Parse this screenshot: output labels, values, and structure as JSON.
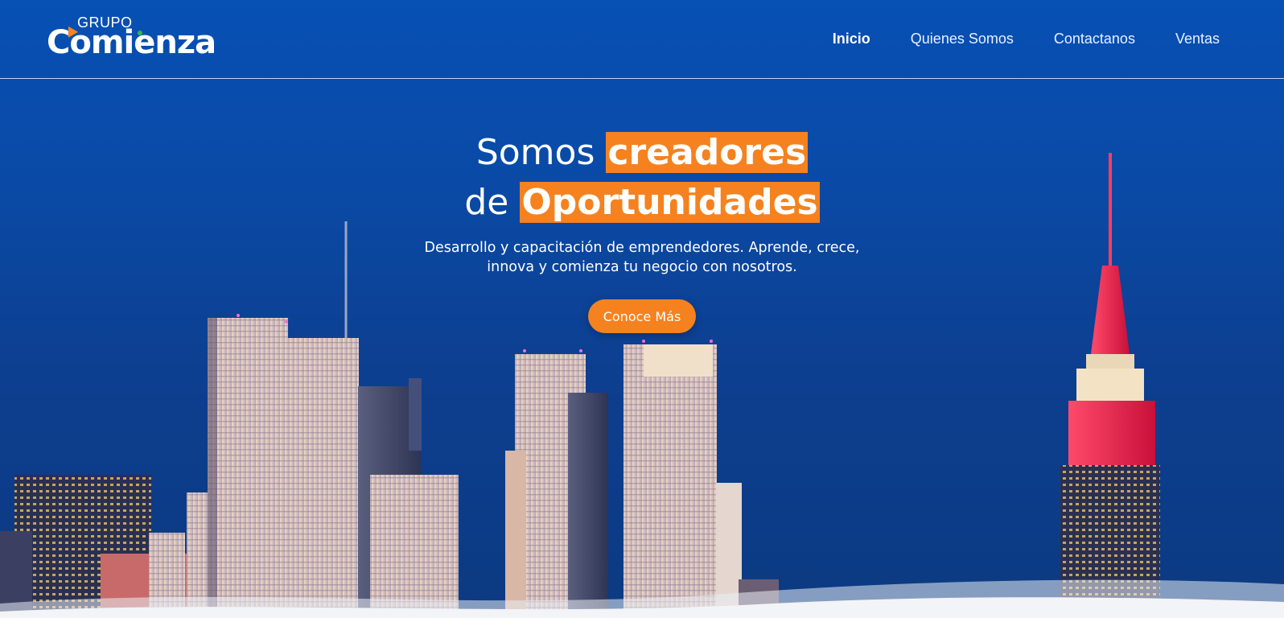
{
  "brand": {
    "small_text": "GRUPO",
    "big_text": "Comienza",
    "colors": {
      "primary_blue": "#0750b4",
      "accent_orange": "#f5821f",
      "accent_green": "#33b54a"
    }
  },
  "nav": {
    "items": [
      {
        "label": "Inicio",
        "active": true
      },
      {
        "label": "Quienes Somos",
        "active": false
      },
      {
        "label": "Contactanos",
        "active": false
      },
      {
        "label": "Ventas",
        "active": false
      }
    ]
  },
  "hero": {
    "line1_prefix": "Somos",
    "line1_highlight": "creadores",
    "line2_prefix": "de",
    "line2_highlight": "Oportunidades",
    "subtitle_line1": "Desarrollo y capacitación de emprendedores. Aprende, crece,",
    "subtitle_line2": "innova y comienza tu negocio con nosotros.",
    "cta_label": "Conoce Más"
  },
  "background": {
    "image": "city-skyline-night-photo"
  }
}
